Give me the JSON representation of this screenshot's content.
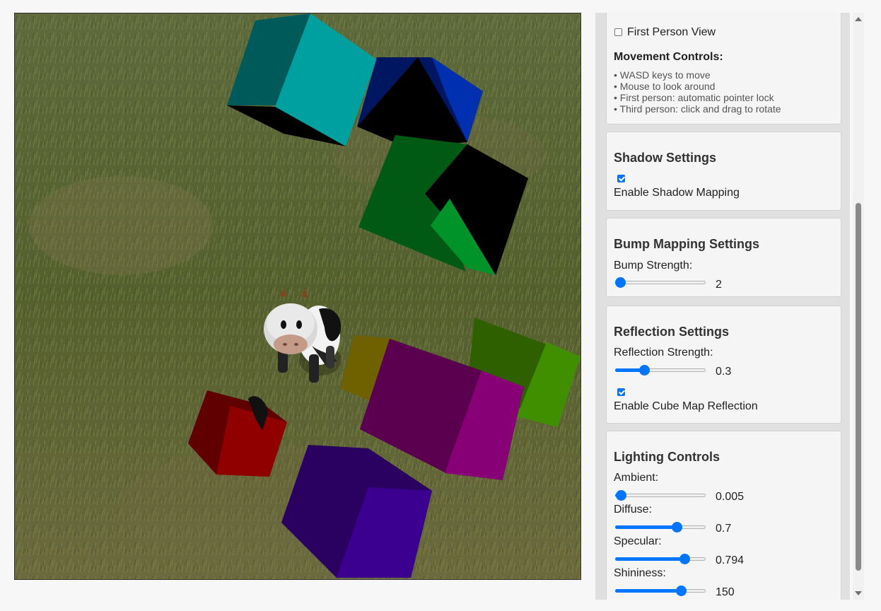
{
  "scene": {
    "background": "grass-field",
    "character": "cow",
    "cube_colors": {
      "cyan": "#00a0a0",
      "navy": "#001a80",
      "green": "#008020",
      "olive": "#807000",
      "lime": "#408000",
      "magenta": "#800070",
      "red": "#900000",
      "indigo": "#3c0090"
    }
  },
  "movement": {
    "first_person_label": "First Person View",
    "first_person_checked": false,
    "title": "Movement Controls:",
    "items": [
      "• WASD keys to move",
      "• Mouse to look around",
      "• First person: automatic pointer lock",
      "• Third person: click and drag to rotate"
    ]
  },
  "shadow": {
    "title": "Shadow Settings",
    "enable_label": "Enable Shadow Mapping",
    "enabled": true
  },
  "bump": {
    "title": "Bump Mapping Settings",
    "strength_label": "Bump Strength:",
    "strength_value": "2",
    "strength_fraction": 0.0
  },
  "reflection": {
    "title": "Reflection Settings",
    "strength_label": "Reflection Strength:",
    "strength_value": "0.3",
    "strength_fraction": 0.3,
    "cubemap_label": "Enable Cube Map Reflection",
    "cubemap_enabled": true
  },
  "lighting": {
    "title": "Lighting Controls",
    "ambient_label": "Ambient:",
    "ambient_value": "0.005",
    "ambient_fraction": 0.005,
    "diffuse_label": "Diffuse:",
    "diffuse_value": "0.7",
    "diffuse_fraction": 0.7,
    "specular_label": "Specular:",
    "specular_value": "0.794",
    "specular_fraction": 0.794,
    "shininess_label": "Shininess:",
    "shininess_value": "150",
    "shininess_fraction": 0.75
  },
  "colors": {
    "accent": "#0075ff",
    "panel": "#e0e0e0",
    "card": "#f5f5f5"
  }
}
